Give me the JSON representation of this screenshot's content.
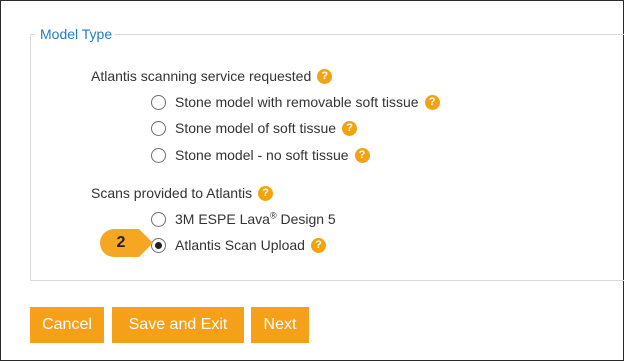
{
  "section": {
    "title": "Model Type"
  },
  "scanning_service": {
    "label": "Atlantis scanning service requested",
    "options": [
      {
        "label": "Stone model with removable soft tissue",
        "selected": false
      },
      {
        "label": "Stone model of soft tissue",
        "selected": false
      },
      {
        "label": "Stone model - no soft tissue",
        "selected": false
      }
    ]
  },
  "scans_provided": {
    "label": "Scans provided to Atlantis",
    "options": [
      {
        "label_prefix": "3M ESPE Lava",
        "label_sup": "®",
        "label_suffix": " Design 5",
        "selected": false
      },
      {
        "label": "Atlantis Scan Upload",
        "selected": true
      }
    ]
  },
  "help_icon": {
    "name": "help-icon",
    "glyph": "?",
    "color": "#f2a311"
  },
  "callout": {
    "number": "2",
    "color": "#f5a623"
  },
  "buttons": {
    "cancel": "Cancel",
    "save_exit": "Save and Exit",
    "next": "Next",
    "color": "#f5a018"
  }
}
